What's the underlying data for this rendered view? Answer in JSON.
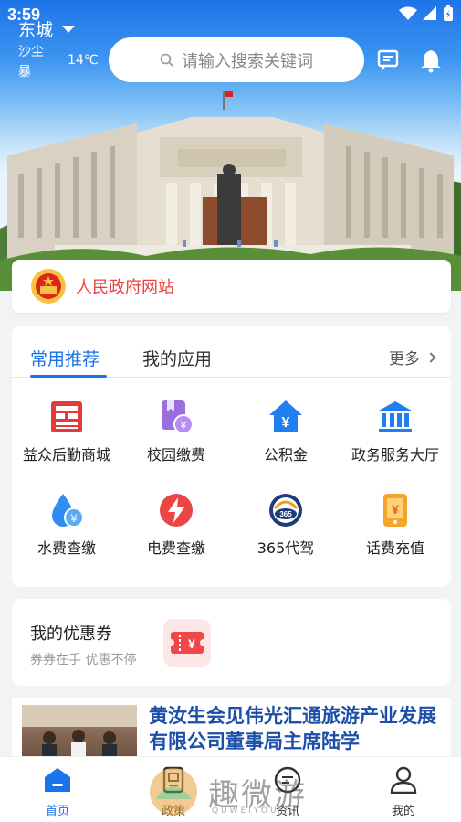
{
  "status_bar": {
    "time": "3:59"
  },
  "header": {
    "city": "东城",
    "weather_desc": "沙尘暴",
    "temperature": "14℃",
    "search_placeholder": "请输入搜索关键词"
  },
  "site_banner": {
    "name": "人民政府网站"
  },
  "apps": {
    "tabs": [
      {
        "label": "常用推荐",
        "active": true
      },
      {
        "label": "我的应用",
        "active": false
      }
    ],
    "more_label": "更多",
    "items": [
      {
        "label": "益众后勤商城",
        "icon": "mall-icon"
      },
      {
        "label": "校园缴费",
        "icon": "campus-fee-icon"
      },
      {
        "label": "公积金",
        "icon": "housing-fund-icon"
      },
      {
        "label": "政务服务大厅",
        "icon": "government-hall-icon"
      },
      {
        "label": "水费查缴",
        "icon": "water-fee-icon"
      },
      {
        "label": "电费查缴",
        "icon": "electricity-fee-icon"
      },
      {
        "label": "365代驾",
        "icon": "designated-driver-icon"
      },
      {
        "label": "话费充值",
        "icon": "phone-recharge-icon"
      }
    ]
  },
  "coupon": {
    "title": "我的优惠券",
    "subtitle": "券券在手 优惠不停"
  },
  "news": {
    "title": "黄汝生会见伟光汇通旅游产业发展有限公司董事局主席陆学"
  },
  "bottom_nav": [
    {
      "label": "首页",
      "active": true,
      "icon": "home-icon"
    },
    {
      "label": "政策",
      "active": false,
      "icon": "policy-icon"
    },
    {
      "label": "资讯",
      "active": false,
      "icon": "news-icon"
    },
    {
      "label": "我的",
      "active": false,
      "icon": "profile-icon"
    }
  ],
  "watermark": {
    "text": "趣微游",
    "sub": "QUWEIYOU"
  },
  "colors": {
    "primary": "#1a73e8",
    "site_red": "#e8423b",
    "news_title": "#1b4fa8"
  }
}
